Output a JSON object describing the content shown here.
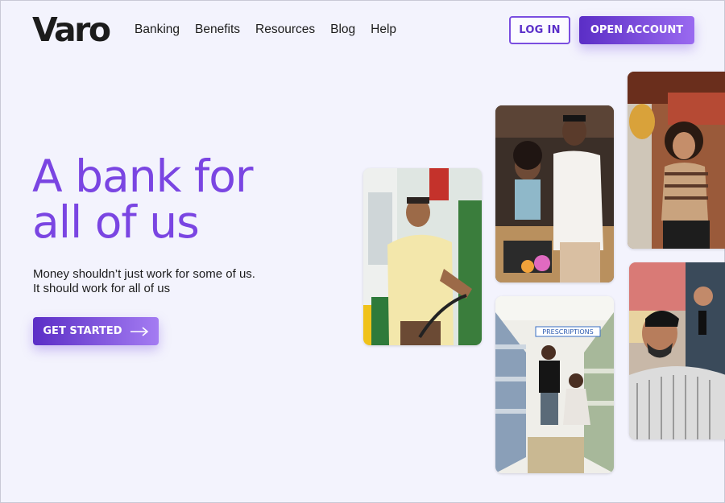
{
  "brand": {
    "logo": "Varo",
    "accent": "#7a45e2"
  },
  "nav": {
    "items": [
      "Banking",
      "Benefits",
      "Resources",
      "Blog",
      "Help"
    ]
  },
  "header": {
    "login_label": "LOG IN",
    "open_account_label": "OPEN ACCOUNT"
  },
  "hero": {
    "title_line1": "A bank for",
    "title_line2": "all of us",
    "subtitle_line1": "Money shouldn’t just work for some of us.",
    "subtitle_line2": "It should work for all of us",
    "cta_label": "GET STARTED",
    "cta_icon": "arrow-right-icon"
  },
  "photos": [
    {
      "name": "gas-station-man-photo",
      "sign_text": ""
    },
    {
      "name": "couple-market-photo",
      "sign_text": ""
    },
    {
      "name": "grocery-woman-photo",
      "sign_text": ""
    },
    {
      "name": "kids-store-aisle-photo",
      "sign_text": "PRESCRIPTIONS"
    },
    {
      "name": "barber-shop-photo",
      "sign_text": ""
    }
  ]
}
